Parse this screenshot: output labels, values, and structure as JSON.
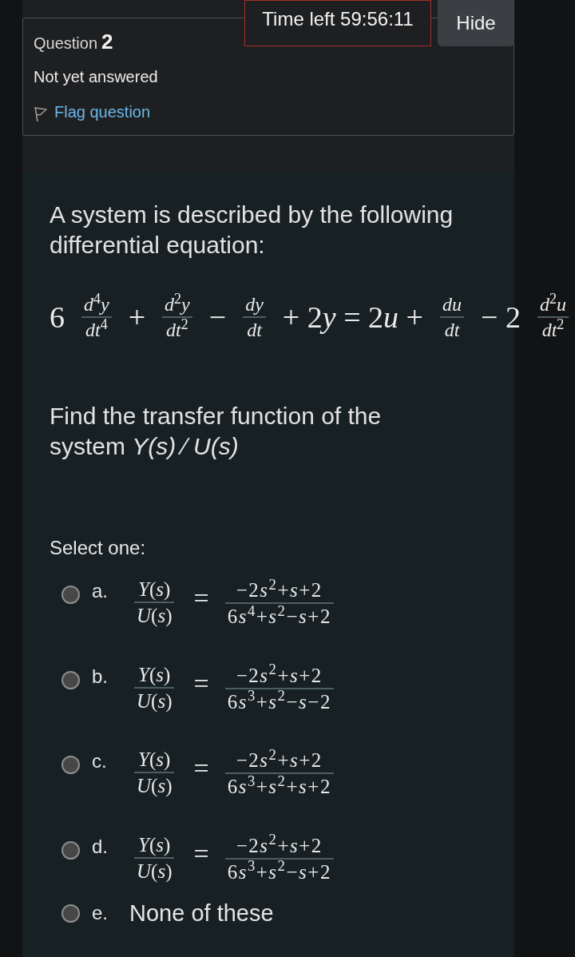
{
  "timer": {
    "label": "Time left 59:56:11"
  },
  "hide_button": {
    "label": "Hide"
  },
  "question_info": {
    "label": "Question",
    "number": "2",
    "status": "Not yet answered",
    "flag_link": "Flag question"
  },
  "question": {
    "text": "A system is described by the following differential equation:",
    "equation": [
      {
        "kind": "term",
        "text": "6"
      },
      {
        "kind": "fraction",
        "numerator": "d$^{4}$y",
        "denominator": "dt$^{4}$"
      },
      {
        "kind": "term",
        "text": "+"
      },
      {
        "kind": "fraction",
        "numerator": "d$^{2}$y",
        "denominator": "dt$^{2}$"
      },
      {
        "kind": "term",
        "text": "−"
      },
      {
        "kind": "fraction",
        "numerator": "dy",
        "denominator": "dt"
      },
      {
        "kind": "term",
        "text": "+ 2y = 2u +"
      },
      {
        "kind": "fraction",
        "numerator": "du",
        "denominator": "dt"
      },
      {
        "kind": "term",
        "text": "− 2"
      },
      {
        "kind": "fraction",
        "numerator": "d$^{2}$u",
        "denominator": "dt$^{2}$"
      }
    ],
    "prompt": "Find the transfer function of the system *Y(s)* ∕ *U(s)*",
    "select_label": "Select one:",
    "options": [
      {
        "kind": "fraction",
        "letter": "a.",
        "selected": false,
        "lhs_numerator": "Y(s)",
        "lhs_denominator": "U(s)",
        "relation": "=",
        "rhs_numerator": "−2s$^{2}$+s+2",
        "rhs_denominator": "6s$^{4}$+s$^{2}$−s+2"
      },
      {
        "kind": "fraction",
        "letter": "b.",
        "selected": false,
        "lhs_numerator": "Y(s)",
        "lhs_denominator": "U(s)",
        "relation": "=",
        "rhs_numerator": "−2s$^{2}$+s+2",
        "rhs_denominator": "6s$^{3}$+s$^{2}$−s−2"
      },
      {
        "kind": "fraction",
        "letter": "c.",
        "selected": false,
        "lhs_numerator": "Y(s)",
        "lhs_denominator": "U(s)",
        "relation": "=",
        "rhs_numerator": "−2s$^{2}$+s+2",
        "rhs_denominator": "6s$^{3}$+s$^{2}$+s+2"
      },
      {
        "kind": "fraction",
        "letter": "d.",
        "selected": false,
        "lhs_numerator": "Y(s)",
        "lhs_denominator": "U(s)",
        "relation": "=",
        "rhs_numerator": "−2s$^{2}$+s+2",
        "rhs_denominator": "6s$^{3}$+s$^{2}$−s+2"
      },
      {
        "kind": "text",
        "letter": "e.",
        "selected": false,
        "text": "None of these"
      }
    ]
  }
}
